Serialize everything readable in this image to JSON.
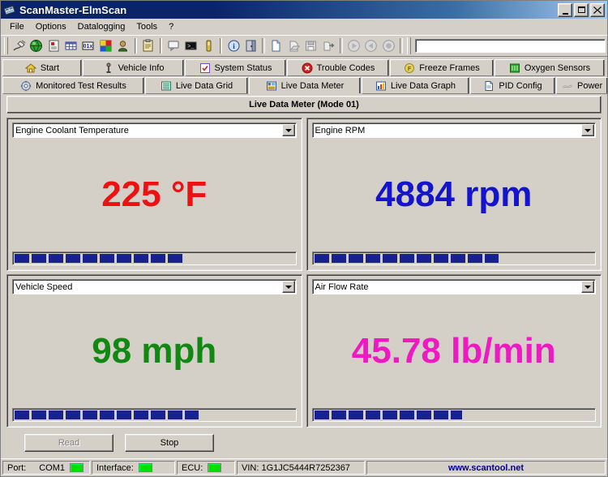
{
  "window": {
    "title": "ScanMaster-ElmScan",
    "icon": "app-scanner-icon",
    "minimize_label": "Minimize",
    "maximize_label": "Maximize",
    "close_label": "Close",
    "titlebar_color": "#0a246a"
  },
  "menu": {
    "items": [
      {
        "label": "File"
      },
      {
        "label": "Options"
      },
      {
        "label": "Datalogging"
      },
      {
        "label": "Tools"
      },
      {
        "label": "?"
      }
    ]
  },
  "toolbar": {
    "buttons": [
      {
        "name": "connect-icon"
      },
      {
        "name": "globe-icon"
      },
      {
        "name": "vehicle-info-icon"
      },
      {
        "name": "grid-icon"
      },
      {
        "name": "dtc-icon"
      },
      {
        "name": "chart-icon"
      },
      {
        "name": "oxygen-sensor-icon"
      },
      {
        "name": "clipboard-icon"
      },
      {
        "name": "terminal-window-icon"
      },
      {
        "name": "console-icon"
      },
      {
        "name": "device-icon"
      },
      {
        "name": "info-icon"
      },
      {
        "name": "exit-icon"
      },
      {
        "name": "new-file-icon"
      },
      {
        "name": "open-file-icon"
      },
      {
        "name": "save-icon"
      },
      {
        "name": "export-icon"
      },
      {
        "name": "play-icon"
      },
      {
        "name": "pause-icon"
      },
      {
        "name": "stop-record-icon"
      }
    ],
    "command_input_value": "",
    "command_input_placeholder": ""
  },
  "tabs": {
    "row1": [
      {
        "label": "Start",
        "icon": "home-icon",
        "active": false
      },
      {
        "label": "Vehicle Info",
        "icon": "vin-icon",
        "active": false
      },
      {
        "label": "System Status",
        "icon": "status-icon",
        "active": false
      },
      {
        "label": "Trouble Codes",
        "icon": "error-icon",
        "active": false
      },
      {
        "label": "Freeze Frames",
        "icon": "freeze-icon",
        "active": false
      },
      {
        "label": "Oxygen Sensors",
        "icon": "o2-icon",
        "active": false
      }
    ],
    "row2": [
      {
        "label": "Monitored Test Results",
        "icon": "gear-icon",
        "active": false
      },
      {
        "label": "Live Data Grid",
        "icon": "list-icon",
        "active": false
      },
      {
        "label": "Live Data Meter",
        "icon": "meter-icon",
        "active": true
      },
      {
        "label": "Live Data Graph",
        "icon": "graph-icon",
        "active": false
      },
      {
        "label": "PID Config",
        "icon": "document-icon",
        "active": false
      },
      {
        "label": "Power",
        "icon": "power-icon",
        "active": false
      }
    ]
  },
  "panel": {
    "title": "Live Data Meter (Mode 01)"
  },
  "gauges": [
    {
      "pid_label": "Engine Coolant Temperature",
      "value": "225 °F",
      "color": "#ee1111",
      "bar_percent": 60
    },
    {
      "pid_label": "Engine RPM",
      "value": "4884 rpm",
      "color": "#1414cc",
      "bar_percent": 66
    },
    {
      "pid_label": "Vehicle Speed",
      "value": "98 mph",
      "color": "#118811",
      "bar_percent": 66
    },
    {
      "pid_label": "Air Flow Rate",
      "value": "45.78 lb/min",
      "color": "#ee19c0",
      "bar_percent": 53
    }
  ],
  "actions": {
    "read_label": "Read",
    "stop_label": "Stop"
  },
  "status": {
    "port_label": "Port:",
    "port_value": "COM1",
    "interface_label": "Interface:",
    "ecu_label": "ECU:",
    "vin_text": "VIN: 1G1JC5444R7252367",
    "url": "www.scantool.net",
    "led_color": "#00e000",
    "url_color": "#00008b"
  }
}
